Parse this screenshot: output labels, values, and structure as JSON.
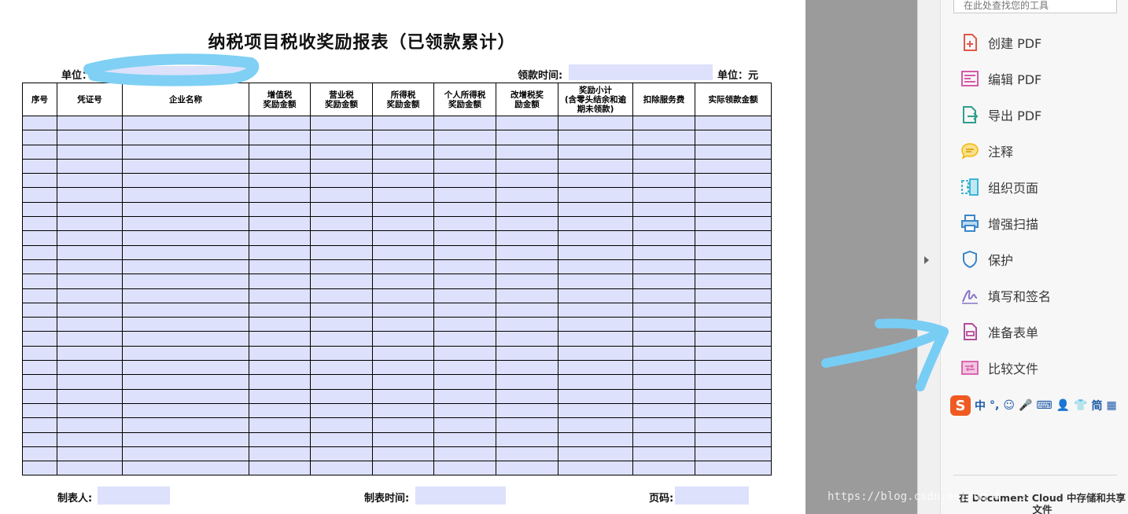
{
  "document": {
    "title": "纳税项目税收奖励报表（已领款累计）",
    "unit_label": "单位：",
    "payment_time_label": "领款时间:",
    "currency_unit": "单位：元",
    "headers": [
      "序号",
      "凭证号",
      "企业名称",
      "增值税\n奖励金额",
      "营业税\n奖励金额",
      "所得税\n奖励金额",
      "个人所得税\n奖励金额",
      "改增税奖\n励金额",
      "奖励小计\n(含零头结余和逾\n期未领款)",
      "扣除服务费",
      "实际领款金额"
    ],
    "empty_row_count": 25,
    "footer": {
      "preparer_label": "制表人:",
      "prepared_time_label": "制表时间:",
      "page_label": "页码:"
    }
  },
  "tools_pane": {
    "search_placeholder": "在此处查找您的工具",
    "tools": [
      {
        "label": "创建 PDF",
        "icon": "create-pdf-icon",
        "color": "#e0584a"
      },
      {
        "label": "编辑 PDF",
        "icon": "edit-pdf-icon",
        "color": "#d65aa8"
      },
      {
        "label": "导出 PDF",
        "icon": "export-pdf-icon",
        "color": "#2f9e8c"
      },
      {
        "label": "注释",
        "icon": "comment-icon",
        "color": "#f2b705"
      },
      {
        "label": "组织页面",
        "icon": "organize-pages-icon",
        "color": "#3fb5d6"
      },
      {
        "label": "增强扫描",
        "icon": "enhance-scan-icon",
        "color": "#3a86c8"
      },
      {
        "label": "保护",
        "icon": "protect-shield-icon",
        "color": "#3a86c8"
      },
      {
        "label": "填写和签名",
        "icon": "fill-sign-icon",
        "color": "#8a73c9"
      },
      {
        "label": "准备表单",
        "icon": "prepare-form-icon",
        "color": "#b44c9b"
      },
      {
        "label": "比较文件",
        "icon": "compare-files-icon",
        "color": "#d65aa8"
      }
    ],
    "ime_bar": {
      "logo": "S",
      "items": [
        "中",
        "°,",
        "☺",
        "🎤",
        "⌨",
        "👤",
        "👕",
        "简",
        "▦"
      ]
    },
    "cloud_text": "在 Document Cloud 中存储和共享文件"
  },
  "watermark": "https://blog.csdn.net/qq_4___5"
}
